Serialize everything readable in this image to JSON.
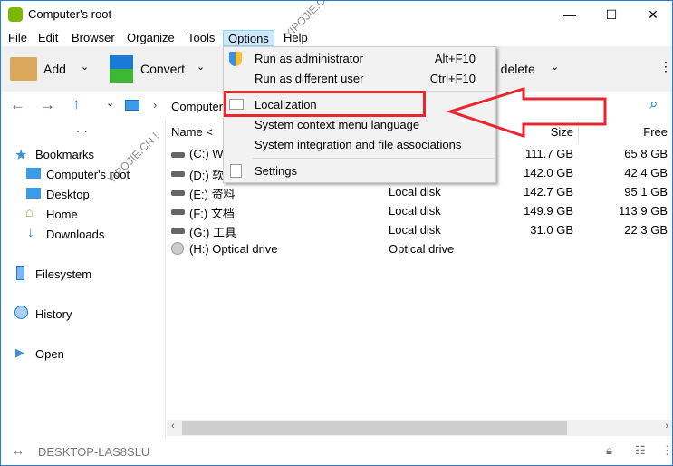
{
  "window": {
    "title": "Computer's root",
    "controls": [
      "—",
      "☐",
      "✕"
    ]
  },
  "menubar": [
    "File",
    "Edit",
    "Browser",
    "Organize",
    "Tools",
    "Options",
    "Help"
  ],
  "toolbar": {
    "add": "Add",
    "convert": "Convert",
    "delete": "e delete"
  },
  "address": {
    "crumb": "Computer"
  },
  "sidebar": {
    "more": "···",
    "bookmarks": "Bookmarks",
    "items": [
      "Computer's root",
      "Desktop",
      "Home",
      "Downloads"
    ],
    "filesystem": "Filesystem",
    "history": "History",
    "open": "Open"
  },
  "columns": {
    "name": "Name <",
    "size": "Size",
    "free": "Free"
  },
  "drives": [
    {
      "name": "(C:) Wi",
      "type": "",
      "size": "111.7 GB",
      "free": "65.8 GB"
    },
    {
      "name": "(D:) 软",
      "type": "",
      "size": "142.0 GB",
      "free": "42.4 GB"
    },
    {
      "name": "(E:) 资料",
      "type": "Local disk",
      "size": "142.7 GB",
      "free": "95.1 GB"
    },
    {
      "name": "(F:) 文档",
      "type": "Local disk",
      "size": "149.9 GB",
      "free": "113.9 GB"
    },
    {
      "name": "(G:) 工具",
      "type": "Local disk",
      "size": "31.0 GB",
      "free": "22.3 GB"
    },
    {
      "name": "(H:) Optical drive",
      "type": "Optical drive",
      "size": "",
      "free": ""
    }
  ],
  "menu": {
    "items": [
      {
        "label": "Run as administrator",
        "shortcut": "Alt+F10"
      },
      {
        "label": "Run as different user",
        "shortcut": "Ctrl+F10"
      },
      {
        "label": "Localization"
      },
      {
        "label": "System context menu language"
      },
      {
        "label": "System integration and file associations"
      },
      {
        "label": "Settings"
      }
    ]
  },
  "status": {
    "computer": "DESKTOP-LAS8SLU"
  },
  "watermark": "YIPOJIE.CN !",
  "colors": {
    "highlight": "#e8262d",
    "accent": "#2b7bd6"
  }
}
